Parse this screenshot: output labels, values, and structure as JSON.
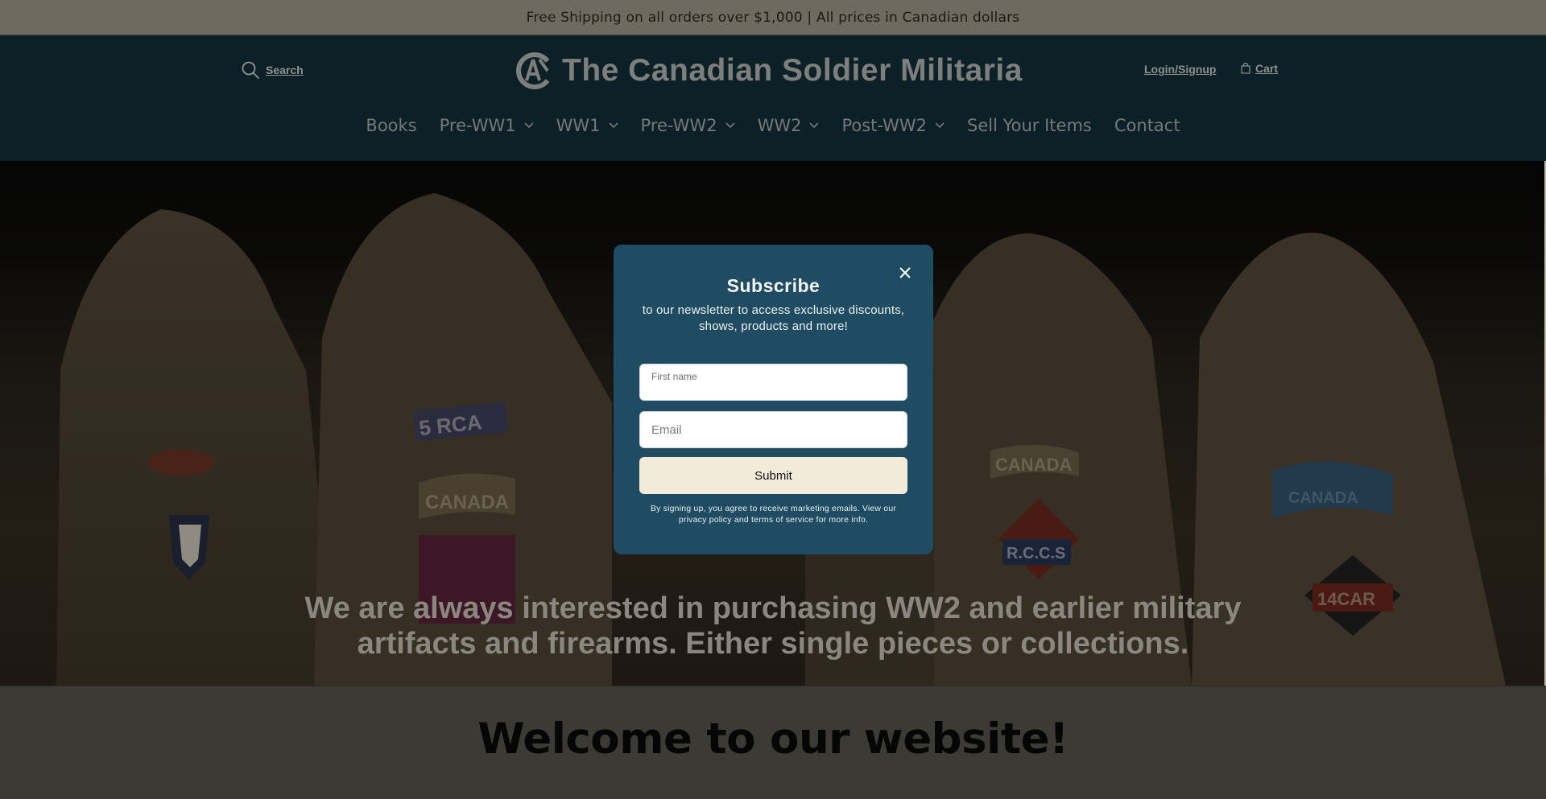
{
  "announcement": {
    "text": "Free Shipping on all orders over $1,000 | All prices in Canadian dollars"
  },
  "header": {
    "search_label": "Search",
    "logo_text": "The Canadian Soldier Militaria",
    "account_label": "Login/Signup",
    "cart_label": "Cart"
  },
  "nav": {
    "items": [
      {
        "label": "Books",
        "dropdown": false
      },
      {
        "label": "Pre-WW1",
        "dropdown": true
      },
      {
        "label": "WW1",
        "dropdown": true
      },
      {
        "label": "Pre-WW2",
        "dropdown": true
      },
      {
        "label": "WW2",
        "dropdown": true
      },
      {
        "label": "Post-WW2",
        "dropdown": true
      },
      {
        "label": "Sell Your Items",
        "dropdown": false
      },
      {
        "label": "Contact",
        "dropdown": false
      }
    ]
  },
  "hero": {
    "caption_line1": "We are always interested in purchasing WW2 and earlier military",
    "caption_line2": "artifacts and firearms. Either single pieces or collections.",
    "patches": [
      "5 RCA",
      "CANADA",
      "CANADA",
      "R.C.C.S",
      "CANADA",
      "14CAR"
    ]
  },
  "welcome": {
    "title": "Welcome to our website!"
  },
  "modal": {
    "title": "Subscribe",
    "description": "to our newsletter to access exclusive discounts, shows, products and more!",
    "first_name_label": "First name",
    "email_placeholder": "Email",
    "submit_label": "Submit",
    "legal": "By signing up, you agree to receive marketing emails. View our privacy policy and terms of service for more info."
  },
  "colors": {
    "header_bg": "#0d2027",
    "announce_bg": "#6f6a5f",
    "modal_bg": "#1f4c62",
    "submit_bg": "#f3ebda"
  }
}
